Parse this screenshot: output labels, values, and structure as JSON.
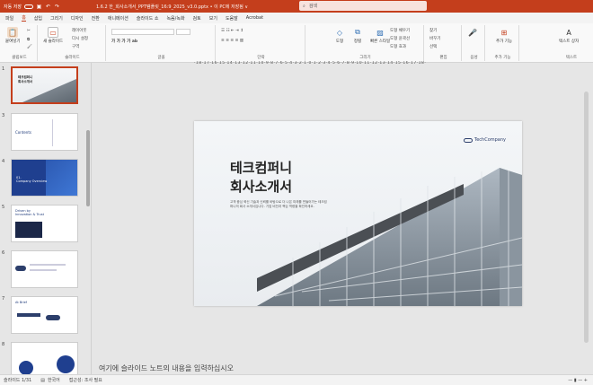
{
  "titlebar": {
    "autosave": "자동 저장",
    "doc_title": "1.6.2 한_회사소개서_PPT템플릿_16:9_2025_v3.0.pptx • 이 PC에 저장됨 ∨",
    "search_placeholder": "검색"
  },
  "menu": {
    "items": [
      "파일",
      "홈",
      "삽입",
      "그리기",
      "디자인",
      "전환",
      "애니메이션",
      "슬라이드 쇼",
      "녹음/녹화",
      "검토",
      "보기",
      "도움말",
      "Acrobat"
    ],
    "active_index": 1
  },
  "ribbon": {
    "paste": "붙여넣기",
    "clipboard": "클립보드",
    "new_slide": "새 슬라이드",
    "layout": "레이아웃",
    "reset": "다시 설정",
    "section": "구역",
    "slides_group": "슬라이드",
    "font_group": "글꼴",
    "paragraph_group": "단락",
    "drawing_group": "그리기",
    "shape": "도형",
    "arrange": "정렬",
    "quick_styles": "빠른 스타일",
    "shape_fill": "도형 채우기",
    "shape_outline": "도형 윤곽선",
    "shape_effects": "도형 효과",
    "find": "찾기",
    "replace": "바꾸기",
    "select": "선택",
    "editing_group": "편집",
    "dictate": "받아쓰기",
    "voice_group": "음성",
    "add_ins": "추가 기능",
    "addins_group": "추가 기능",
    "text_fit": "텍스트 상자",
    "text_group": "텍스트"
  },
  "ruler": "·18·17·16·15·14·13·12·11·10·9·8·7·6·5·4·3·2·1·0·1·2·3·4·5·6·7·8·9·10·11·12·13·14·15·16·17·18·",
  "thumbnails": [
    {
      "num": "1",
      "title": "테크컴퍼니\n회사소개서"
    },
    {
      "num": "3",
      "title": "Contents"
    },
    {
      "num": "4",
      "title": "01.\nCompany Overview"
    },
    {
      "num": "5",
      "title": "Driven by\nInnovation & Trust"
    },
    {
      "num": "6",
      "title": ""
    },
    {
      "num": "7",
      "title": "At Brief"
    },
    {
      "num": "8",
      "title": ""
    }
  ],
  "slide": {
    "title_line1": "테크컴퍼니",
    "title_line2": "회사소개서",
    "subtitle": "고객 중심 혁신 기술과 신뢰를 바탕으로 더 나은 미래를 만들어가는 테크컴퍼니의 회사 소개서입니다. 기업 비전과 핵심 역량을 확인하세요.",
    "logo_text": "TechCompany"
  },
  "notes_placeholder": "여기에 슬라이드 노트의 내용을 입력하십시오",
  "status": {
    "slide_info": "슬라이드 1/31",
    "language": "한국어",
    "accessibility": "접근성: 조사 필요"
  },
  "colors": {
    "accent": "#c43e1c",
    "logo_blue": "#2c3e6b"
  }
}
